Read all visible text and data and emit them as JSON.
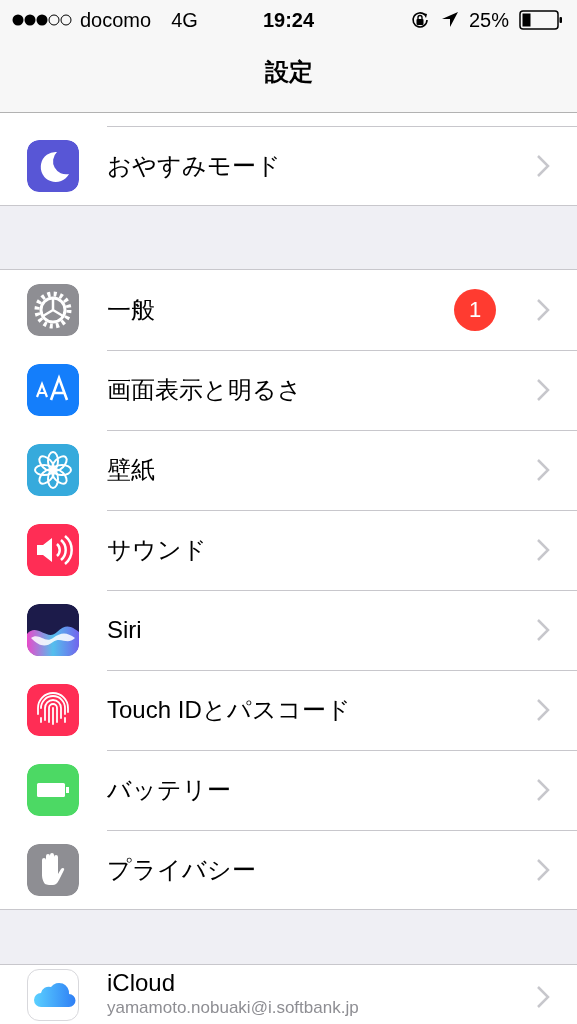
{
  "status_bar": {
    "carrier": "docomo",
    "network": "4G",
    "time": "19:24",
    "battery": "25%"
  },
  "nav_bar": {
    "title": "設定"
  },
  "sections": [
    {
      "items": [
        {
          "label": "おやすみモード"
        }
      ]
    },
    {
      "items": [
        {
          "label": "一般",
          "badge": "1"
        },
        {
          "label": "画面表示と明るさ"
        },
        {
          "label": "壁紙"
        },
        {
          "label": "サウンド"
        },
        {
          "label": "Siri"
        },
        {
          "label": "Touch IDとパスコード"
        },
        {
          "label": "バッテリー"
        },
        {
          "label": "プライバシー"
        }
      ]
    },
    {
      "items": [
        {
          "label": "iCloud",
          "subtitle": "yamamoto.nobuaki@i.softbank.jp"
        }
      ]
    }
  ]
}
